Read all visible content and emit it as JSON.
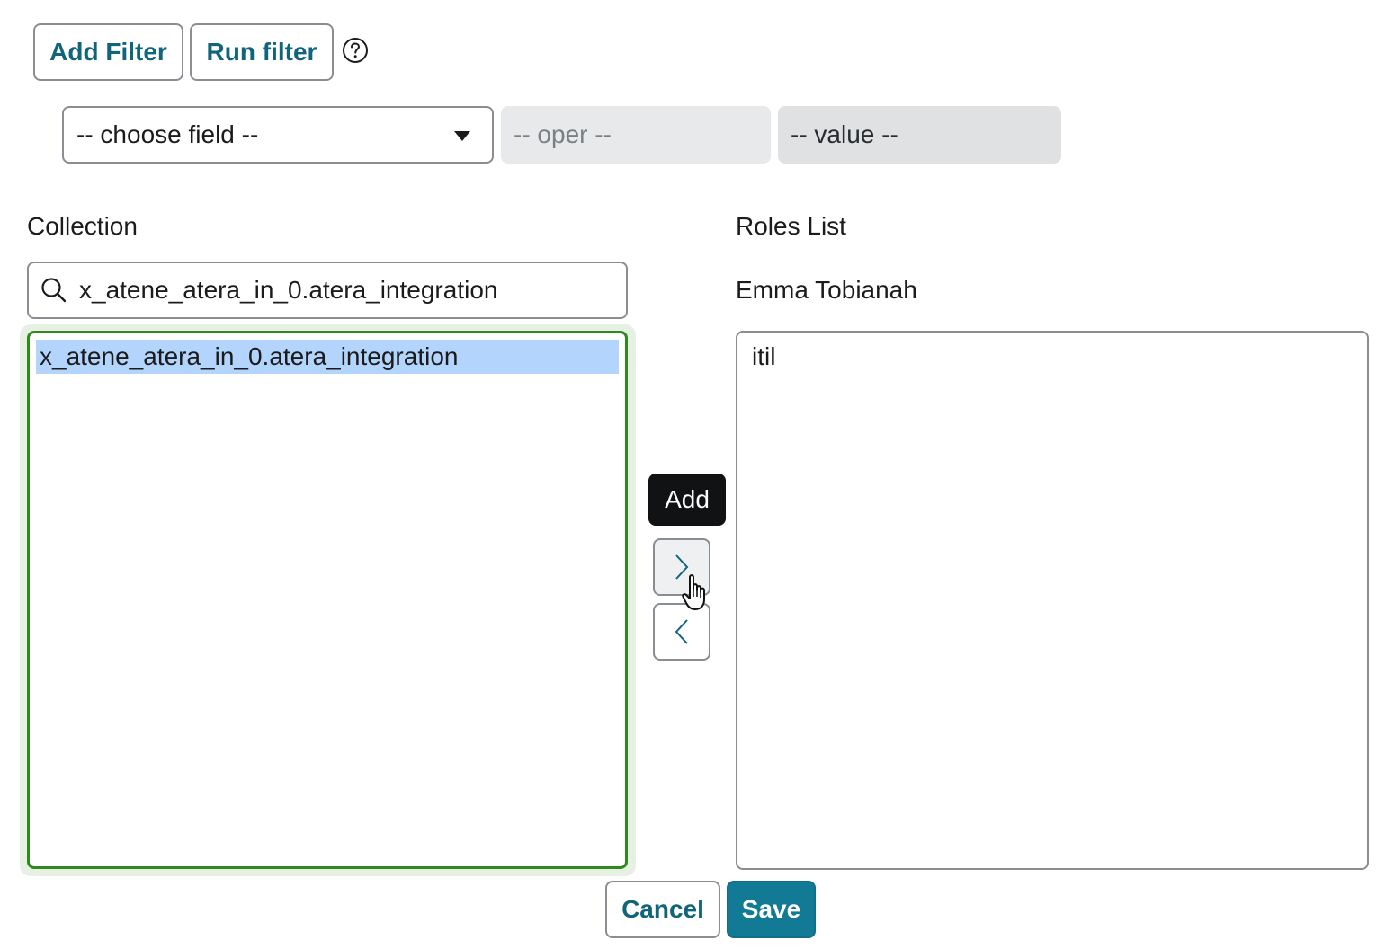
{
  "toolbar": {
    "add_filter_label": "Add Filter",
    "run_filter_label": "Run filter",
    "help_icon": "question-circle-icon"
  },
  "condition": {
    "field_value": "-- choose field --",
    "oper_value": "-- oper --",
    "value_value": "-- value --"
  },
  "collection": {
    "label": "Collection",
    "search_value": "x_atene_atera_in_0.atera_integration",
    "items": [
      {
        "label": "x_atene_atera_in_0.atera_integration",
        "selected": true
      }
    ]
  },
  "roles": {
    "label": "Roles List",
    "user_name": "Emma Tobianah",
    "items": [
      {
        "label": "itil"
      }
    ]
  },
  "transfer": {
    "tooltip": "Add",
    "add_icon": "chevron-right-icon",
    "remove_icon": "chevron-left-icon"
  },
  "footer": {
    "cancel_label": "Cancel",
    "save_label": "Save"
  },
  "colors": {
    "accent": "#11647a",
    "primary_button": "#137a96",
    "focus_border": "#2e8a1e",
    "selection": "#b3d4fc"
  }
}
